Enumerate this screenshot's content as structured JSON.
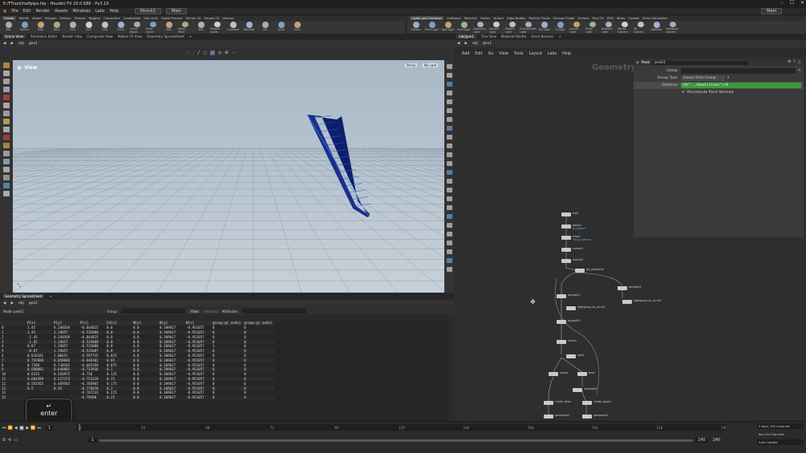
{
  "window": {
    "title": "E:/FTrack/halfpipe.hip - Houdini FX 20.0.688 - Py3.10"
  },
  "menubar": {
    "items": [
      "File",
      "Edit",
      "Render",
      "Assets",
      "Windows",
      "Labs",
      "Help"
    ],
    "desktop_left": "Pinsck1",
    "desktop_right": "Main",
    "desktop_far_right": "Main"
  },
  "shelf_left": {
    "tabs": [
      "Create",
      "Modify",
      "Model",
      "Polygon",
      "Deform",
      "Texture",
      "Rigging",
      "Characters",
      "Constraints",
      "Hair Utils",
      "Guide Process",
      "Terrain FX",
      "Simple FX",
      "Volume"
    ],
    "tools": [
      "Box",
      "Sphere",
      "Tube",
      "Torus",
      "Grid",
      "Null",
      "Line",
      "Circle",
      "Curve Bezier",
      "Draw Curve",
      "Path",
      "Spray Paint",
      "Text",
      "Platonic Solids",
      "L-System",
      "Metaball",
      "File",
      "Spiral",
      "Helix"
    ]
  },
  "shelf_right": {
    "tabs": [
      "Lights and Cameras",
      "Collisions",
      "Particles",
      "Grains",
      "Vellum",
      "Rigid Bodies",
      "Particle Fluids",
      "Viscous Fluids",
      "Oceans",
      "Pyro FX",
      "FEM",
      "Wires",
      "Crowds",
      "Drive Simulation"
    ],
    "tools": [
      "Camera",
      "Point Light",
      "Spot Light",
      "Area Light",
      "Geometry Light",
      "Volume Light",
      "Distant Light",
      "Environment Light",
      "Sky Light",
      "GI Light",
      "Caustic Light",
      "Portal Light",
      "Ambient Light",
      "Stereo Camera",
      "VR Camera",
      "Switcher",
      "Gamepad Camera"
    ]
  },
  "left_panes": {
    "tabs": [
      "Scene View",
      "Animation Editor",
      "Render View",
      "Composite View",
      "Motion FX View",
      "Geometry Spreadsheet"
    ],
    "path": [
      "obj",
      "geo1"
    ],
    "viewport_label": "View",
    "persp_menu": "Persp",
    "cam_menu": "No cam"
  },
  "right_panes": {
    "tabs": [
      "/obj/geo1",
      "Tree View",
      "Material Palette",
      "Asset Browser"
    ],
    "path": [
      "obj",
      "geo1"
    ],
    "menus": [
      "Add",
      "Edit",
      "Go",
      "View",
      "Tools",
      "Layout",
      "Labs",
      "Help"
    ],
    "network_watermark": "Geometry"
  },
  "params": {
    "node_type": "Peak",
    "node_name": "peak1",
    "rows": [
      {
        "label": "Group",
        "value": ""
      },
      {
        "label": "Group Type",
        "value": "Guess from Group"
      },
      {
        "label": "Distance",
        "value": "ch(\"../box1/sizex\")/4"
      }
    ],
    "checkbox_label": "Recompute Point Normals"
  },
  "spreadsheet": {
    "tab": "Geometry Spreadsheet",
    "path": [
      "obj",
      "geo1"
    ],
    "node_label": "Node: peak1",
    "group_label": "Group:",
    "view_label": "View",
    "intrinsics_label": "Intrinsics",
    "attributes_label": "Attributes:",
    "columns": [
      "",
      "P[x]",
      "P[y]",
      "P[z]",
      "Cd[x]",
      "N[x]",
      "N[y]",
      "N[z]",
      "group:gr_endsi",
      "group:gr_endsi"
    ],
    "rows": [
      [
        "0",
        "1.45",
        "0.248569",
        "-0.844825",
        "0.0",
        "0.0",
        "0.309017",
        "-0.951057",
        "0",
        "0"
      ],
      [
        "1",
        "1.45",
        "1.19057",
        "-0.535088",
        "0.0",
        "0.0",
        "0.309017",
        "-0.951057",
        "0",
        "0"
      ],
      [
        "2",
        "-1.45",
        "0.248569",
        "-0.844825",
        "0.0",
        "0.0",
        "0.309017",
        "-0.951057",
        "0",
        "0"
      ],
      [
        "3",
        "-1.45",
        "1.19057",
        "-0.535088",
        "0.0",
        "0.0",
        "0.309017",
        "-0.951057",
        "0",
        "0"
      ],
      [
        "4",
        "0.87",
        "1.19057",
        "-0.535088",
        "0.0",
        "0.0",
        "0.309017",
        "-0.951057",
        "1",
        "0"
      ],
      [
        "5",
        "-0.87",
        "1.19057",
        "-0.535087",
        "0.0",
        "0.0",
        "0.309017",
        "-0.951057",
        "0",
        "0"
      ],
      [
        "6",
        "0.926181",
        "1.00651",
        "-0.597735",
        "0.025",
        "0.0",
        "0.309017",
        "-0.951057",
        "0",
        "0"
      ],
      [
        "7",
        "0.792909",
        "0.858686",
        "-0.648302",
        "0.05",
        "0.0",
        "0.309017",
        "-0.951057",
        "0",
        "0"
      ],
      [
        "8",
        "0.7390",
        "0.730102",
        "-0.685396",
        "0.075",
        "0.0",
        "0.309017",
        "-0.951057",
        "0",
        "0"
      ],
      [
        "9",
        "0.690881",
        "0.648881",
        "-0.713936",
        "0.1",
        "0.0",
        "0.309017",
        "-0.951057",
        "0",
        "0"
      ],
      [
        "10",
        "0.6515",
        "0.560975",
        "-0.736",
        "0.125",
        "0.0",
        "0.309017",
        "-0.951057",
        "0",
        "0"
      ],
      [
        "11",
        "0.604399",
        "0.527374",
        "-0.753318",
        "0.15",
        "0.0",
        "0.309017",
        "-0.951057",
        "0",
        "0"
      ],
      [
        "12",
        "0.565562",
        "0.469583",
        "-0.766905",
        "0.175",
        "0.0",
        "0.309017",
        "-0.951057",
        "0",
        "0"
      ],
      [
        "13",
        "0.5",
        "0.45",
        "-0.776878",
        "0.2",
        "0.0",
        "0.309017",
        "-0.951057",
        "0",
        "0"
      ],
      [
        "14",
        "",
        "",
        "-0.787233",
        "0.225",
        "0.0",
        "0.309017",
        "-0.951057",
        "0",
        "0"
      ],
      [
        "15",
        "",
        "",
        "-0.79498",
        "0.25",
        "0.0",
        "0.309017",
        "-0.951057",
        "0",
        "0"
      ]
    ]
  },
  "network_nodes": [
    {
      "label": "box1",
      "sub": ""
    },
    {
      "label": "group1",
      "sub": "gr_bottom"
    },
    {
      "label": "blast1",
      "sub": "not gr_bottom"
    },
    {
      "label": "normal1",
      "sub": ""
    },
    {
      "label": "normal2",
      "sub": ""
    },
    {
      "label": "grt_orignalize",
      "sub": ""
    },
    {
      "label": "polysplit1",
      "sub": ""
    },
    {
      "label": "polysplit2",
      "sub": ""
    },
    {
      "label": "edgegroup_to_curve1",
      "sub": ""
    },
    {
      "label": "edgegroup_to_curve2",
      "sub": ""
    },
    {
      "label": "polysplit3",
      "sub": ""
    },
    {
      "label": "carve1",
      "sub": ""
    },
    {
      "label": "split1",
      "sub": ""
    },
    {
      "label": "sweep",
      "sub": ""
    },
    {
      "label": "base",
      "sub": ""
    },
    {
      "label": "resample1",
      "sub": ""
    },
    {
      "label": "create_tpipe",
      "sub": ""
    },
    {
      "label": "create_tpipe2",
      "sub": ""
    },
    {
      "label": "groupexpr1",
      "sub": ""
    },
    {
      "label": "groupexpr2",
      "sub": ""
    }
  ],
  "timeline": {
    "ticks": [
      "1",
      "24",
      "48",
      "72",
      "96",
      "120",
      "144",
      "168",
      "192",
      "216",
      "240"
    ],
    "current_frame": "1",
    "start_frame": "1",
    "end_frame": "240",
    "end_frame2": "240",
    "keys_label": "0 keys, 0/0 channels",
    "key_all_label": "Key All Channels",
    "auto_update": "Auto Update"
  },
  "overlay": {
    "key_label": "enter",
    "key_symbol": "↵"
  },
  "colors": {
    "geometry": "#0d1f6b",
    "param_highlight": "#3a9a3a",
    "viewport_top": "#aab8c6"
  }
}
